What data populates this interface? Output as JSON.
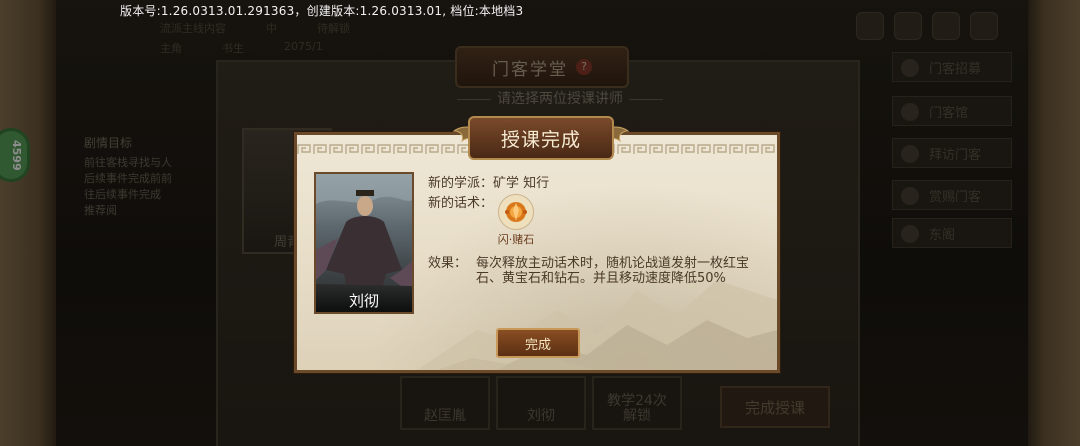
{
  "version_text": "版本号:1.26.0313.01.291363，创建版本:1.26.0313.01, 档位:本地档3",
  "side_badge": "4599",
  "left_panel": {
    "header": "剧情目标",
    "lines": [
      "前往客栈寻找与人",
      "后续事件完成前前",
      "往后续事件完成",
      "推荐阅"
    ]
  },
  "top_table": {
    "row1": [
      "流派主线内容",
      "中",
      "待解锁"
    ],
    "row2": [
      "主角",
      "书生",
      "2075/1"
    ]
  },
  "right_menu": {
    "items": [
      "门客招募",
      "门客馆",
      "拜访门客",
      "赏赐门客",
      "东阁"
    ]
  },
  "under_dialog": {
    "title": "门客学堂",
    "help": "?",
    "subtitle": "请选择两位授课讲师",
    "portrait_name": "周青",
    "slots": [
      "赵匡胤",
      "刘彻",
      "教学24次\n解锁"
    ],
    "complete_teaching": "完成授课"
  },
  "modal": {
    "title": "授课完成",
    "character_name": "刘彻",
    "school_label": "新的学派：",
    "school_value": "矿学  知行",
    "skill_label": "新的话术：",
    "skill_name": "闪·赌石",
    "effect_label": "效果：",
    "effect_line1": "每次释放主动话术时，随机论战道发射一枚红宝",
    "effect_line2": "石、黄宝石和钻石。并且移动速度降低50%",
    "done_button": "完成"
  },
  "colors": {
    "modal_bg": "#ebe2cf",
    "modal_border": "#6b4a2a",
    "button_bg": "#7a4220",
    "title_text": "#f5ead2",
    "skill_text": "#6b3a1a"
  }
}
